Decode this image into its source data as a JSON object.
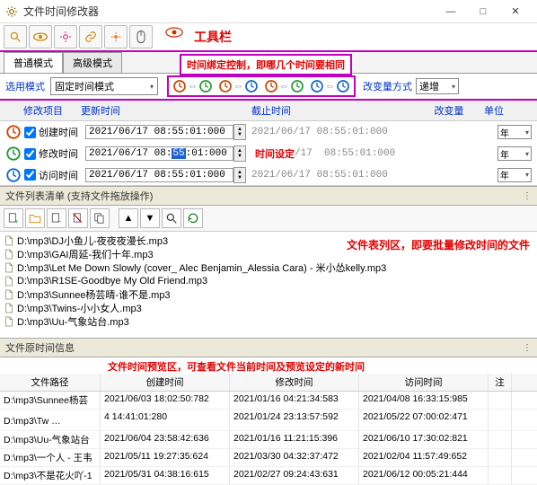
{
  "window": {
    "title": "文件时间修改器"
  },
  "toolbar_label": "工具栏",
  "tabs": {
    "normal": "普通模式",
    "advanced": "高级模式"
  },
  "redbox_bind": "时间绑定控制，即哪几个时间要相同",
  "mode": {
    "label": "选用模式",
    "value": "固定时间模式",
    "change_label": "改变量方式",
    "change_value": "递增"
  },
  "headers": {
    "item": "修改项目",
    "update": "更新时间",
    "deadline": "截止时间",
    "delta": "改变量",
    "unit": "单位"
  },
  "rows": {
    "create": {
      "label": "创建时间",
      "dt": "2021/06/17  08:55:01:000",
      "dt2": "2021/06/17  08:55:01:000",
      "unit": "年"
    },
    "modify": {
      "label": "修改时间",
      "dt_pre": "2021/06/17  08:",
      "dt_hl": "55",
      "dt_post": ":01:000",
      "dt2": "2021/06/17  08:55:01:000",
      "unit": "年",
      "anno": "时间设定"
    },
    "access": {
      "label": "访问时间",
      "dt": "2021/06/17  08:55:01:000",
      "dt2": "2021/06/17  08:55:01:000",
      "unit": "年"
    }
  },
  "filelist": {
    "header": "文件列表清单   (支持文件拖放操作)",
    "anno": "文件表列区，即要批量修改时间的文件",
    "items": [
      "D:\\mp3\\DJ小鱼儿-夜夜夜漫长.mp3",
      "D:\\mp3\\GAI周延-我们十年.mp3",
      "D:\\mp3\\Let Me Down Slowly (cover_ Alec Benjamin_Alessia Cara) - 米小怂kelly.mp3",
      "D:\\mp3\\R1SE-Goodbye My Old Friend.mp3",
      "D:\\mp3\\Sunnee杨芸晴-谁不是.mp3",
      "D:\\mp3\\Twins-小小女人.mp3",
      "D:\\mp3\\Uu-气象站台.mp3"
    ]
  },
  "origtime": {
    "header": "文件原时间信息",
    "anno": "文件时间预览区，可查看文件当前时间及预览设定的新时间",
    "cols": {
      "path": "文件路径",
      "create": "创建时间",
      "modify": "修改时间",
      "access": "访问时间",
      "note": "注"
    },
    "tooltip": "D:\\mp3\\Uu-气象站台.mp3",
    "rows": [
      {
        "path": "D:\\mp3\\Sunnee杨芸",
        "c": "2021/06/03 18:02:50:782",
        "m": "2021/01/16 04:21:34:583",
        "a": "2021/04/08 16:33:15:985"
      },
      {
        "path": "D:\\mp3\\Tw",
        "c": "4 14:41:01:280",
        "m": "2021/01/24 23:13:57:592",
        "a": "2021/05/22 07:00:02:471"
      },
      {
        "path": "D:\\mp3\\Uu-气象站台",
        "c": "2021/06/04 23:58:42:636",
        "m": "2021/01/16 11:21:15:396",
        "a": "2021/06/10 17:30:02:821"
      },
      {
        "path": "D:\\mp3\\一个人 - 王韦",
        "c": "2021/05/11 19:27:35:624",
        "m": "2021/03/30 04:32:37:472",
        "a": "2021/02/04 11:57:49:652"
      },
      {
        "path": "D:\\mp3\\不是花火吖-1",
        "c": "2021/05/31 04:38:16:615",
        "m": "2021/02/27 09:24:43:631",
        "a": "2021/06/12 00:05:21:444"
      }
    ]
  }
}
